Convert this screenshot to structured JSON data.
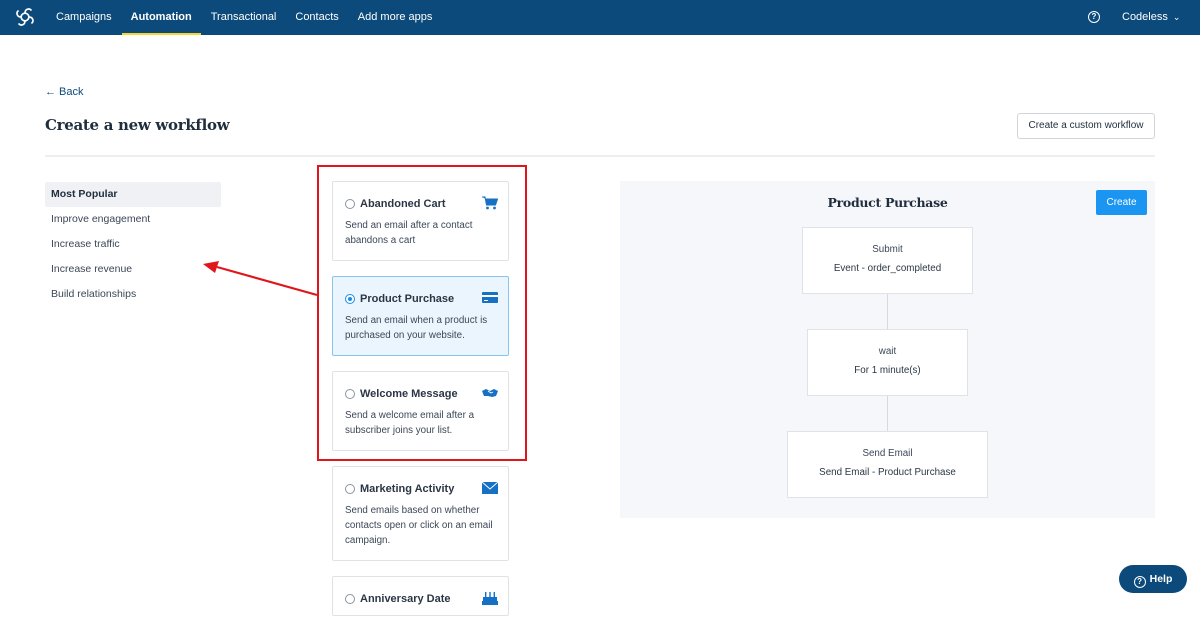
{
  "topbar": {
    "logo_icon": "sendinblue-logo-icon",
    "nav": [
      {
        "label": "Campaigns",
        "active": false
      },
      {
        "label": "Automation",
        "active": true
      },
      {
        "label": "Transactional",
        "active": false
      },
      {
        "label": "Contacts",
        "active": false
      },
      {
        "label": "Add more apps",
        "active": false
      }
    ],
    "help_icon": "question-circle-icon",
    "account_label": "Codeless",
    "account_chevron": "⌄"
  },
  "header": {
    "back_label": "← Back",
    "title": "Create a new workflow",
    "custom_workflow_button": "Create a custom workflow"
  },
  "categories": [
    {
      "label": "Most Popular",
      "active": true
    },
    {
      "label": "Improve engagement",
      "active": false
    },
    {
      "label": "Increase traffic",
      "active": false
    },
    {
      "label": "Increase revenue",
      "active": false
    },
    {
      "label": "Build relationships",
      "active": false
    }
  ],
  "workflows": [
    {
      "title": "Abandoned Cart",
      "description": "Send an email after a contact abandons a cart",
      "icon": "shopping-cart-icon",
      "selected": false
    },
    {
      "title": "Product Purchase",
      "description": "Send an email when a product is purchased on your website.",
      "icon": "credit-card-icon",
      "selected": true
    },
    {
      "title": "Welcome Message",
      "description": "Send a welcome email after a subscriber joins your list.",
      "icon": "handshake-icon",
      "selected": false
    },
    {
      "title": "Marketing Activity",
      "description": "Send emails based on whether contacts open or click on an email campaign.",
      "icon": "envelope-icon",
      "selected": false
    },
    {
      "title": "Anniversary Date",
      "description": "",
      "icon": "birthday-cake-icon",
      "selected": false
    }
  ],
  "preview": {
    "title": "Product Purchase",
    "create_button": "Create",
    "steps": [
      {
        "type": "Submit",
        "detail": "Event - order_completed"
      },
      {
        "type": "wait",
        "detail": "For 1 minute(s)"
      },
      {
        "type": "Send Email",
        "detail": "Send Email - Product Purchase"
      }
    ]
  },
  "help_button": {
    "label": "Help",
    "icon": "question-circle-icon"
  },
  "colors": {
    "topbar": "#0b4a7a",
    "nav_active_underline": "#f5d635",
    "accent": "#1b95f2",
    "annotation_red": "#e0161b",
    "selected_card_bg": "#eaf5fd"
  }
}
